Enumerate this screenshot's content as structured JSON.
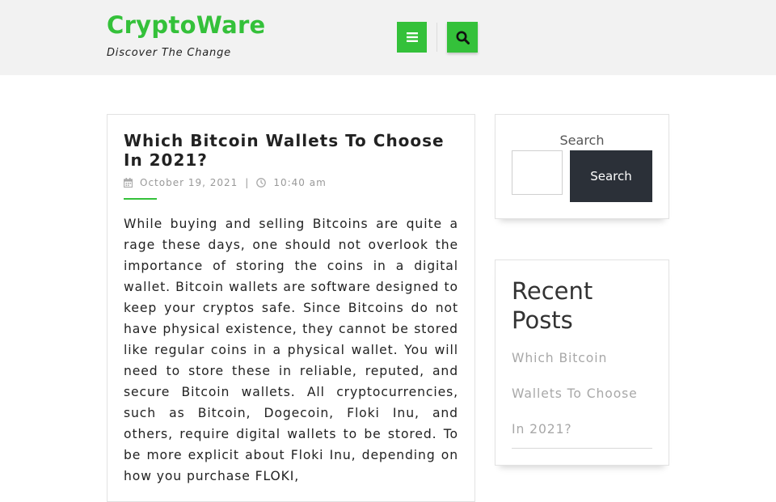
{
  "header": {
    "site_title": "CryptoWare",
    "tagline": "Discover The Change",
    "menu_icon": "hamburger-menu-icon",
    "search_icon": "search-icon",
    "accent_color": "#34c13a"
  },
  "post": {
    "title": "Which Bitcoin Wallets To Choose In 2021?",
    "date": "October 19, 2021",
    "separator": "|",
    "time": "10:40 am",
    "date_icon": "calendar-icon",
    "time_icon": "clock-icon",
    "excerpt": "While buying and selling Bitcoins are quite a rage these days, one should not overlook the importance of storing the coins in a digital wallet. Bitcoin wallets are software designed to keep your cryptos safe. Since Bitcoins do not have physical existence, they cannot be stored like regular coins in a physical wallet. You will need to store these in reliable, reputed, and secure Bitcoin wallets. All cryptocurrencies, such as Bitcoin, Dogecoin, Floki Inu, and others, require digital wallets to be stored. To be more explicit about Floki Inu, depending on how you purchase FLOKI,"
  },
  "sidebar": {
    "search": {
      "label": "Search",
      "input_value": "",
      "button_label": "Search",
      "button_color": "#2b3038"
    },
    "recent_posts": {
      "title": "Recent Posts",
      "items": [
        {
          "label": "Which Bitcoin Wallets To Choose In 2021?"
        }
      ]
    }
  }
}
